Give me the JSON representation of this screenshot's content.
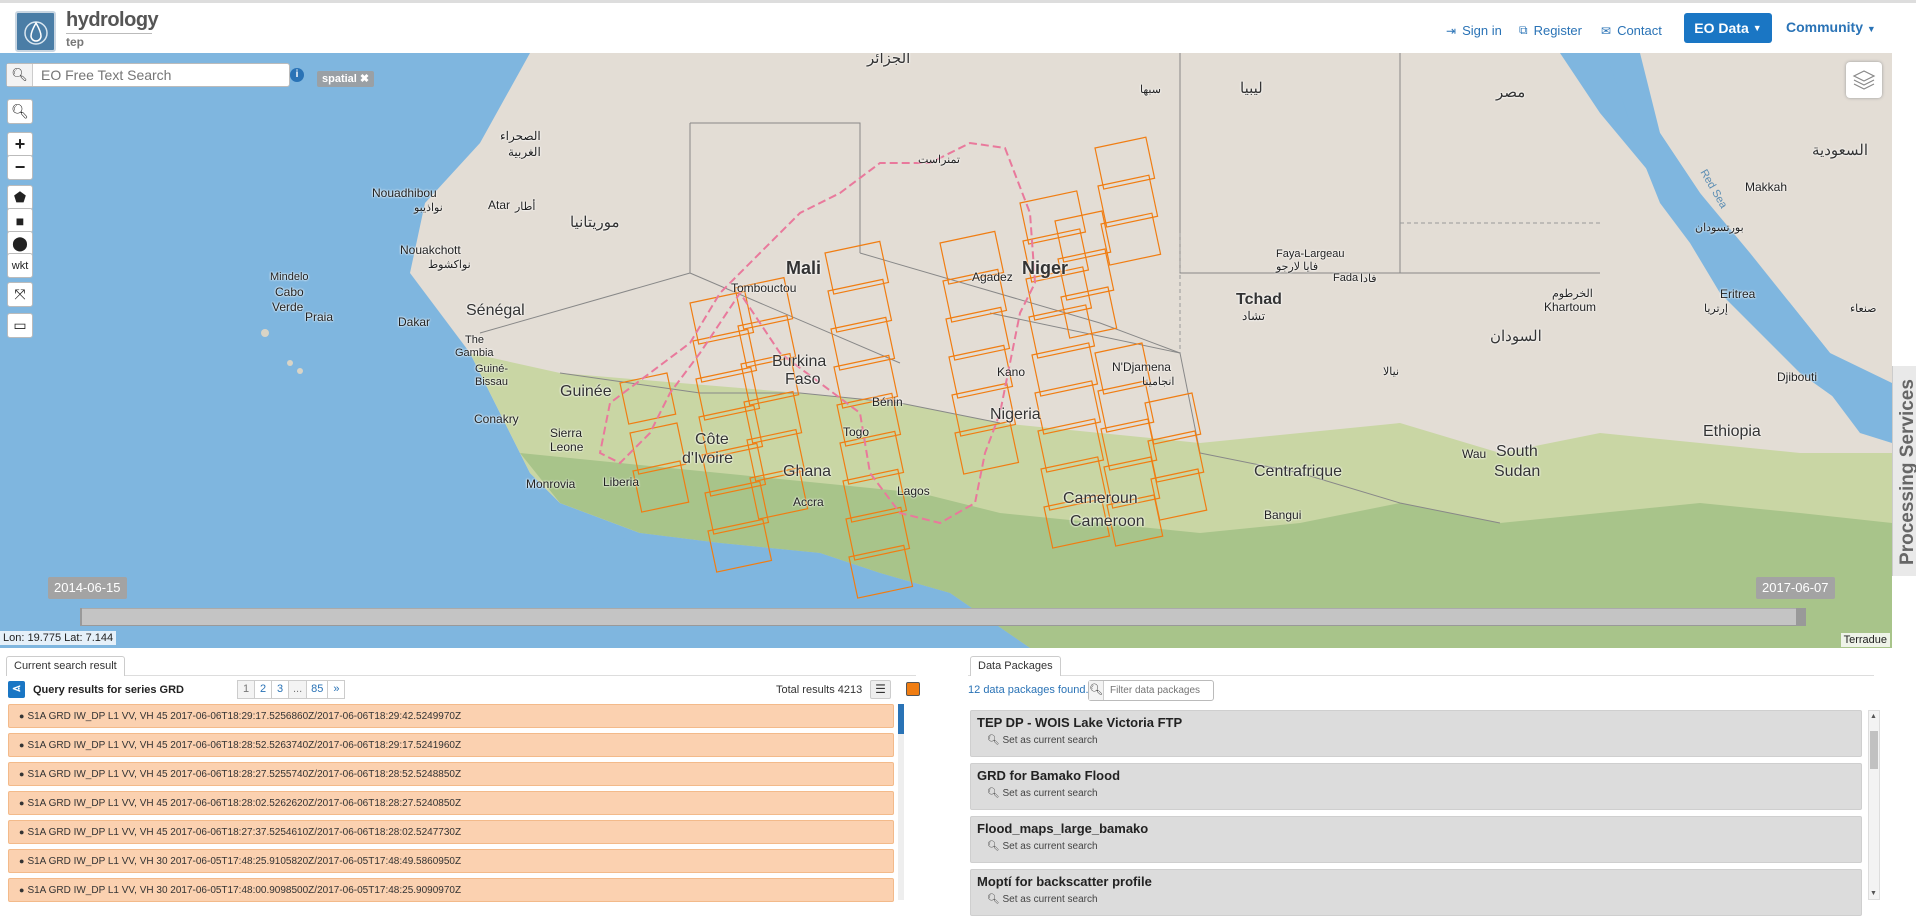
{
  "brand": {
    "title": "hydrology",
    "subtitle": "tep"
  },
  "nav": {
    "sign_in": "Sign in",
    "register": "Register",
    "contact": "Contact",
    "eo_data": "EO Data",
    "community": "Community"
  },
  "search": {
    "placeholder": "EO Free Text Search",
    "info": "i",
    "spatial_tag": "spatial"
  },
  "map_tools": {
    "wkt": "wkt"
  },
  "map_labels": {
    "algeria": "الجزائر",
    "libya": "ليبيا",
    "egypt": "مصر",
    "saudi": "السعودية",
    "sebha": "سبها",
    "sahara1": "الصحراء",
    "sahara2": "الغربية",
    "nouadhibou": "Nouadhibou",
    "nouadhibou_ar": "نواذيبو",
    "atar": "Atar",
    "atar_ar": "أطار",
    "mauritania_ar": "موريتانيا",
    "nouakchott": "Nouakchott",
    "nouakchott_ar": "نواكشوط",
    "tamanrasset": "تمنراست",
    "mali": "Mali",
    "niger": "Niger",
    "tchad": "Tchad",
    "tchad_ar": "تشاد",
    "tombouctou": "Tombouctou",
    "agadez": "Agadez",
    "faya": "Faya-Largeau",
    "faya_ar": "فايا لارجو",
    "fada": "Fada",
    "fada_ar": "فادا",
    "mindelo": "Mindelo",
    "cabo": "Cabo",
    "verde": "Verde",
    "praia": "Praia",
    "dakar": "Dakar",
    "senegal": "Sénégal",
    "gambia1": "The",
    "gambia2": "Gambia",
    "guinebissau1": "Guiné-",
    "guinebissau2": "Bissau",
    "burkina1": "Burkina",
    "burkina2": "Faso",
    "conakry": "Conakry",
    "guinee": "Guinée",
    "sierra1": "Sierra",
    "sierra2": "Leone",
    "cotedivoire1": "Côte",
    "cotedivoire2": "d'Ivoire",
    "ghana": "Ghana",
    "togo": "Togo",
    "benin": "Bénin",
    "nigeria": "Nigeria",
    "kano": "Kano",
    "ndjamena": "N'Djamena",
    "ndjamena_ar": "انجامينا",
    "monrovia": "Monrovia",
    "liberia": "Liberia",
    "accra": "Accra",
    "lagos": "Lagos",
    "cameroun": "Cameroun",
    "cameroon": "Cameroon",
    "centrafrique": "Centrafrique",
    "bangui": "Bangui",
    "wau": "Wau",
    "southsudan1": "South",
    "southsudan2": "Sudan",
    "sudan_ar": "السودان",
    "khartoum": "Khartoum",
    "khartoum_ar": "الخرطوم",
    "nyala": "نيالا",
    "eritrea": "Eritrea",
    "eritrea_ar": "إرتريا",
    "ethiopia": "Ethiopia",
    "djibouti": "Djibouti",
    "sanaa": "صنعاء",
    "makkah": "Makkah",
    "portsudan": "بورتسودان",
    "redsea": "Red Sea"
  },
  "timeline": {
    "start": "2014-06-15",
    "end": "2017-06-07"
  },
  "map_footer": {
    "coords": "Lon: 19.775 Lat: 7.144",
    "attribution": "Terradue"
  },
  "side_tab": "Processing Services",
  "results": {
    "tab": "Current search result",
    "heading": "Query results for series GRD",
    "pages": [
      "1",
      "2",
      "3",
      "...",
      "85",
      "»"
    ],
    "total_label": "Total results",
    "total": "4213",
    "colors": {
      "row": "#fbd1b0",
      "accent": "#f07d12"
    },
    "rows": [
      "S1A GRD IW_DP L1 VV, VH 45 2017-06-06T18:29:17.5256860Z/2017-06-06T18:29:42.5249970Z",
      "S1A GRD IW_DP L1 VV, VH 45 2017-06-06T18:28:52.5263740Z/2017-06-06T18:29:17.5241960Z",
      "S1A GRD IW_DP L1 VV, VH 45 2017-06-06T18:28:27.5255740Z/2017-06-06T18:28:52.5248850Z",
      "S1A GRD IW_DP L1 VV, VH 45 2017-06-06T18:28:02.5262620Z/2017-06-06T18:28:27.5240850Z",
      "S1A GRD IW_DP L1 VV, VH 45 2017-06-06T18:27:37.5254610Z/2017-06-06T18:28:02.5247730Z",
      "S1A GRD IW_DP L1 VV, VH 30 2017-06-05T17:48:25.9105820Z/2017-06-05T17:48:49.5860950Z",
      "S1A GRD IW_DP L1 VV, VH 30 2017-06-05T17:48:00.9098500Z/2017-06-05T17:48:25.9090970Z"
    ]
  },
  "packages": {
    "tab": "Data Packages",
    "count": "12",
    "found_label": "data packages found.",
    "filter_placeholder": "Filter data packages",
    "set_current": "Set as current search",
    "items": [
      "TEP DP - WOIS Lake Victoria FTP",
      "GRD for Bamako Flood",
      "Flood_maps_large_bamako",
      "Moptí for backscatter profile"
    ]
  }
}
